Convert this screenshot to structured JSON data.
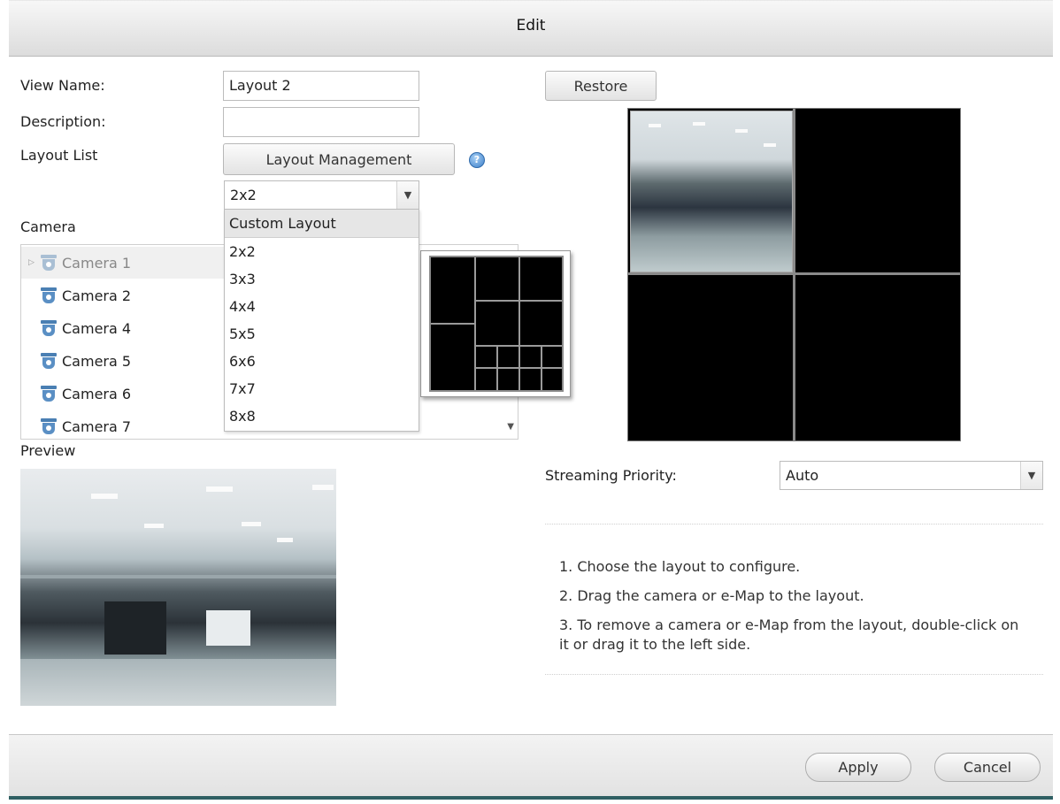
{
  "dialog": {
    "title": "Edit"
  },
  "form": {
    "view_name_label": "View Name:",
    "view_name_value": "Layout 2",
    "description_label": "Description:",
    "description_value": "",
    "layout_list_label": "Layout List",
    "layout_management_button": "Layout Management",
    "help_icon_glyph": "?",
    "layout_select_value": "2x2",
    "restore_button": "Restore"
  },
  "layout_dropdown": {
    "items": [
      "Custom Layout",
      "2x2",
      "3x3",
      "4x4",
      "5x5",
      "6x6",
      "7x7",
      "8x8"
    ],
    "highlighted": "Custom Layout"
  },
  "camera_section": {
    "label": "Camera",
    "cameras": [
      "Camera 1",
      "Camera 2",
      "Camera 4",
      "Camera 5",
      "Camera 6",
      "Camera 7"
    ],
    "icon": "camera-icon"
  },
  "preview": {
    "label": "Preview"
  },
  "streaming": {
    "label": "Streaming Priority:",
    "value": "Auto"
  },
  "instructions": [
    "1. Choose the layout to configure.",
    "2. Drag the camera or e-Map to the layout.",
    "3. To remove a camera or e-Map from the layout, double-click on it or drag it to the left side."
  ],
  "footer": {
    "apply_button": "Apply",
    "cancel_button": "Cancel"
  },
  "colors": {
    "accent": "#4a7fb3",
    "footer_bar": "#2f5f63"
  }
}
